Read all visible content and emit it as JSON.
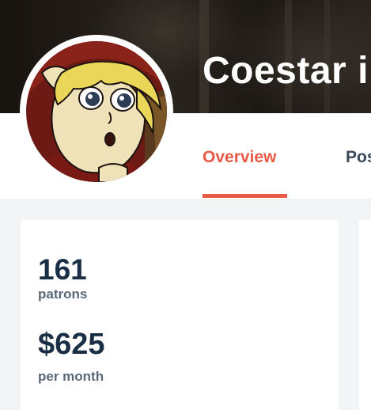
{
  "header": {
    "creator_name": "Coestar i"
  },
  "nav": {
    "tabs": [
      {
        "label": "Overview",
        "active": true
      },
      {
        "label": "Pos",
        "active": false
      }
    ]
  },
  "stats": {
    "patrons": {
      "value": "161",
      "label": "patrons"
    },
    "earnings": {
      "value": "$625",
      "label": "per month"
    }
  },
  "colors": {
    "accent": "#e85b46",
    "title_text": "#1a2e45",
    "secondary_text": "#5b6878",
    "banner": "#1f1b17",
    "page_background": "#f3f4f6"
  },
  "icons": {
    "avatar": "cartoon-character-portrait"
  }
}
